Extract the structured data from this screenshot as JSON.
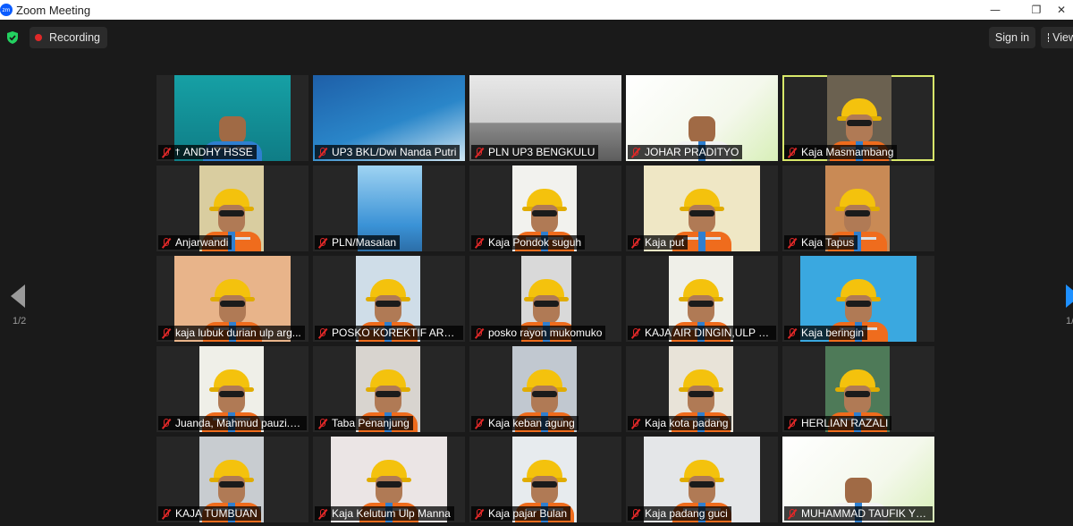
{
  "window": {
    "title": "Zoom Meeting",
    "logo_text": "zm",
    "min_glyph": "—",
    "max_glyph": "❐",
    "close_glyph": "✕"
  },
  "toolbar": {
    "recording_label": "Recording",
    "signin_label": "Sign in",
    "view_label": "View"
  },
  "pager": {
    "page_label": "1/2"
  },
  "colors": {
    "accent": "#0b5cff",
    "record_red": "#e02828",
    "mute_red": "#e02828",
    "speaker_outline": "#d8e86a",
    "helmet": "#f4c20d",
    "vest": "#ef6c1d"
  },
  "participants": [
    {
      "name": "ANDHY HSSE",
      "pinned": true,
      "kind": "slide-teal"
    },
    {
      "name": "UP3 BKL/Dwi Nanda Putri",
      "kind": "slide-blue"
    },
    {
      "name": "PLN UP3 BENGKULU",
      "kind": "room"
    },
    {
      "name": "JOHAR PRADITYO",
      "kind": "slide-white"
    },
    {
      "name": "Kaja Masmambang",
      "kind": "worker",
      "speaking": true
    },
    {
      "name": "Anjarwandi",
      "kind": "worker"
    },
    {
      "name": "PLN/Masalan",
      "kind": "sky"
    },
    {
      "name": "Kaja Pondok suguh",
      "kind": "worker"
    },
    {
      "name": "Kaja put",
      "kind": "worker"
    },
    {
      "name": "Kaja Tapus",
      "kind": "worker"
    },
    {
      "name": "kaja lubuk durian ulp arg...",
      "kind": "worker"
    },
    {
      "name": "POSKO KOREKTIF ARGAM...",
      "kind": "worker"
    },
    {
      "name": "posko rayon mukomuko",
      "kind": "worker"
    },
    {
      "name": "KAJA AIR DINGIN,ULP CU...",
      "kind": "worker"
    },
    {
      "name": "Kaja beringin",
      "kind": "worker-banner"
    },
    {
      "name": "Juanda, Mahmud pauzi.w...",
      "kind": "worker"
    },
    {
      "name": "Taba Penanjung",
      "kind": "worker"
    },
    {
      "name": "Kaja keban agung",
      "kind": "worker"
    },
    {
      "name": "Kaja kota padang",
      "kind": "worker"
    },
    {
      "name": "HERLIAN RAZALI",
      "kind": "worker"
    },
    {
      "name": "KAJA TUMBUAN",
      "kind": "worker"
    },
    {
      "name": "Kaja Kelutum Ulp Manna",
      "kind": "worker"
    },
    {
      "name": "Kaja pajar Bulan",
      "kind": "worker"
    },
    {
      "name": "Kaja padang guci",
      "kind": "worker"
    },
    {
      "name": "MUHAMMAD TAUFIK YU...",
      "kind": "slide-white"
    }
  ]
}
